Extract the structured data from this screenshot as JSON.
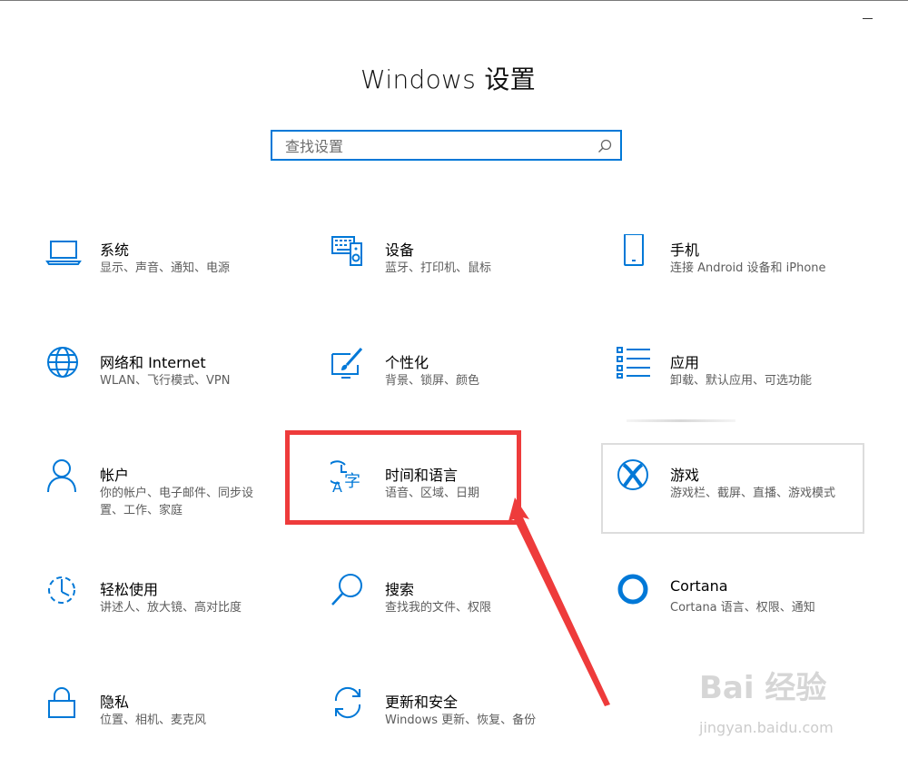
{
  "window": {
    "title": "Windows 设置",
    "minimize_glyph": "—"
  },
  "search": {
    "placeholder": "查找设置",
    "icon": "search-icon"
  },
  "tiles": [
    {
      "title": "系统",
      "desc": "显示、声音、通知、电源",
      "icon": "laptop-icon"
    },
    {
      "title": "设备",
      "desc": "蓝牙、打印机、鼠标",
      "icon": "keyboard-speaker-icon"
    },
    {
      "title": "手机",
      "desc": "连接 Android 设备和 iPhone",
      "icon": "phone-icon"
    },
    {
      "title": "网络和 Internet",
      "desc": "WLAN、飞行模式、VPN",
      "icon": "globe-icon"
    },
    {
      "title": "个性化",
      "desc": "背景、锁屏、颜色",
      "icon": "paint-brush-icon"
    },
    {
      "title": "应用",
      "desc": "卸载、默认应用、可选功能",
      "icon": "apps-list-icon"
    },
    {
      "title": "帐户",
      "desc": "你的帐户、电子邮件、同步设置、工作、家庭",
      "icon": "person-icon"
    },
    {
      "title": "时间和语言",
      "desc": "语音、区域、日期",
      "icon": "time-language-icon"
    },
    {
      "title": "游戏",
      "desc": "游戏栏、截屏、直播、游戏模式",
      "icon": "xbox-icon"
    },
    {
      "title": "轻松使用",
      "desc": "讲述人、放大镜、高对比度",
      "icon": "ease-of-access-icon"
    },
    {
      "title": "搜索",
      "desc": "查找我的文件、权限",
      "icon": "search-magnifier-icon"
    },
    {
      "title": "Cortana",
      "desc": "Cortana 语言、权限、通知",
      "icon": "cortana-icon"
    },
    {
      "title": "隐私",
      "desc": "位置、相机、麦克风",
      "icon": "lock-icon"
    },
    {
      "title": "更新和安全",
      "desc": "Windows 更新、恢复、备份",
      "icon": "refresh-icon"
    }
  ],
  "annotation": {
    "highlight_color": "#ee3b3b",
    "target": "时间和语言"
  },
  "watermark": {
    "logo": "Bai 经验",
    "url": "jingyan.baidu.com"
  },
  "colors": {
    "accent": "#0078d7",
    "description_text": "#5d5d5d",
    "highlight": "#ee3b3b"
  }
}
